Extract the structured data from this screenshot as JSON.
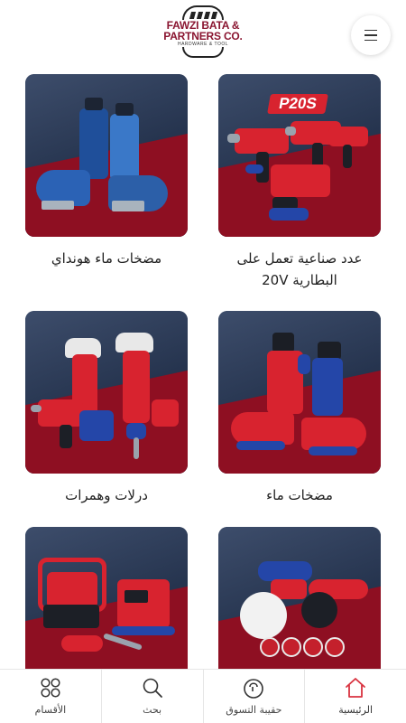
{
  "brand": {
    "line1": "FAWZI BATA &",
    "line2": "PARTNERS CO.",
    "tagline": "HARDWARE & TOOL"
  },
  "header": {
    "menu_icon": "hamburger-icon"
  },
  "categories": [
    {
      "label": "عدد صناعية تعمل على البطارية 20V",
      "badge": "P20S"
    },
    {
      "label": "مضخات ماء هونداي"
    },
    {
      "label": "مضخات ماء"
    },
    {
      "label": "درلات وهمرات"
    },
    {
      "label": ""
    },
    {
      "label": ""
    }
  ],
  "bottom_nav": [
    {
      "label": "الرئيسية",
      "icon": "home-icon",
      "active": true,
      "accent": "#d93340"
    },
    {
      "label": "حقيبة التسوق",
      "icon": "shopping-bag-icon",
      "active": false
    },
    {
      "label": "بحث",
      "icon": "search-icon",
      "active": false
    },
    {
      "label": "الأقسام",
      "icon": "categories-grid-icon",
      "active": false
    }
  ],
  "colors": {
    "brand_red": "#8a1530",
    "accent": "#d93340",
    "card_bg": "#2a3a55"
  }
}
